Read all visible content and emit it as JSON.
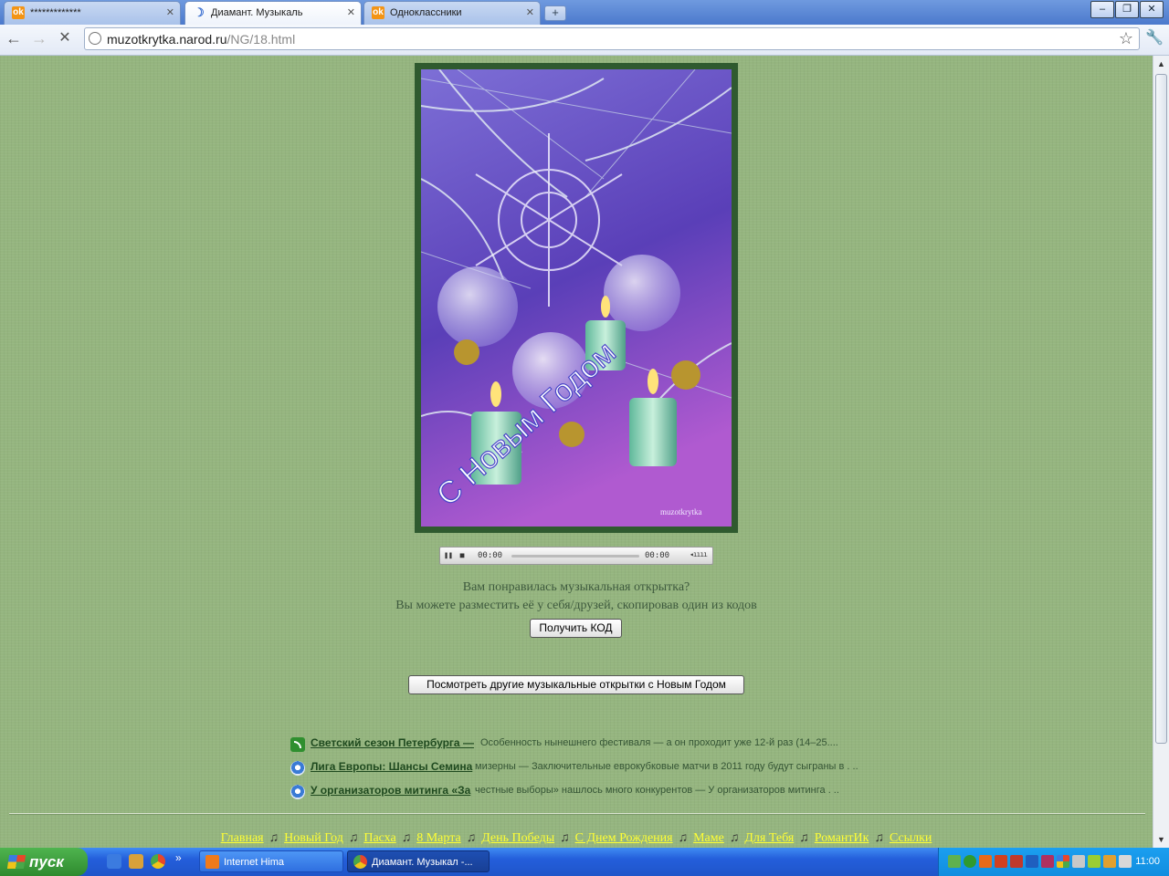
{
  "browser": {
    "tabs": [
      {
        "title": "*************",
        "icon": "odnoklassniki-icon"
      },
      {
        "title": "Диамант. Музыкаль",
        "icon": "loading-icon"
      },
      {
        "title": "Одноклассники",
        "icon": "odnoklassniki-icon"
      }
    ],
    "address": {
      "host": "muzotkrytka.narod.ru",
      "path": "/NG/18.html"
    }
  },
  "card": {
    "greeting": "С Новым Годом",
    "watermark": "muzotkrytka"
  },
  "player": {
    "elapsed": "00:00",
    "duration": "00:00",
    "progress": 0
  },
  "content": {
    "line1": "Вам понравилась музыкальная открытка?",
    "line2": "Вы можете разместить её у себя/друзей, скопировав один из кодов",
    "get_code_button": "Получить КОД",
    "more_cards_button": "Посмотреть другие музыкальные открытки с Новым Годом"
  },
  "news": [
    {
      "headline": "Светский сезон Петербурга —",
      "text": "Особенность нынешнего фестиваля — а он проходит уже 12-й раз (14–25....",
      "icon": "rss-icon"
    },
    {
      "headline": "Лига Европы: Шансы Семина",
      "text": "мизерны — Заключительные еврокубковые матчи в 2011 году будут сыграны в . ..",
      "icon": "news-globe-icon"
    },
    {
      "headline": "У организаторов митинга «За",
      "text": "честные выборы» нашлось много конкурентов — У организаторов митинга . ..",
      "icon": "news-globe-icon"
    }
  ],
  "footer_nav": [
    "Главная",
    "Новый Год",
    "Пасха",
    "8 Марта",
    "День Победы",
    "С Днем Рождения",
    "Маме",
    "Для Тебя",
    "РомантИк",
    "Ссылки"
  ],
  "footer_separator": "♫",
  "taskbar": {
    "start_label": "пуск",
    "tasks": [
      {
        "label": "Internet Hima",
        "icon": "app-icon"
      },
      {
        "label": "Диамант. Музыкал -...",
        "icon": "chrome-icon"
      }
    ],
    "overflow": "»",
    "clock": "11:00"
  },
  "colors": {
    "page_bg": "#95b57f",
    "footer_link": "#ffff33",
    "card_frame": "#2f5a2f"
  }
}
